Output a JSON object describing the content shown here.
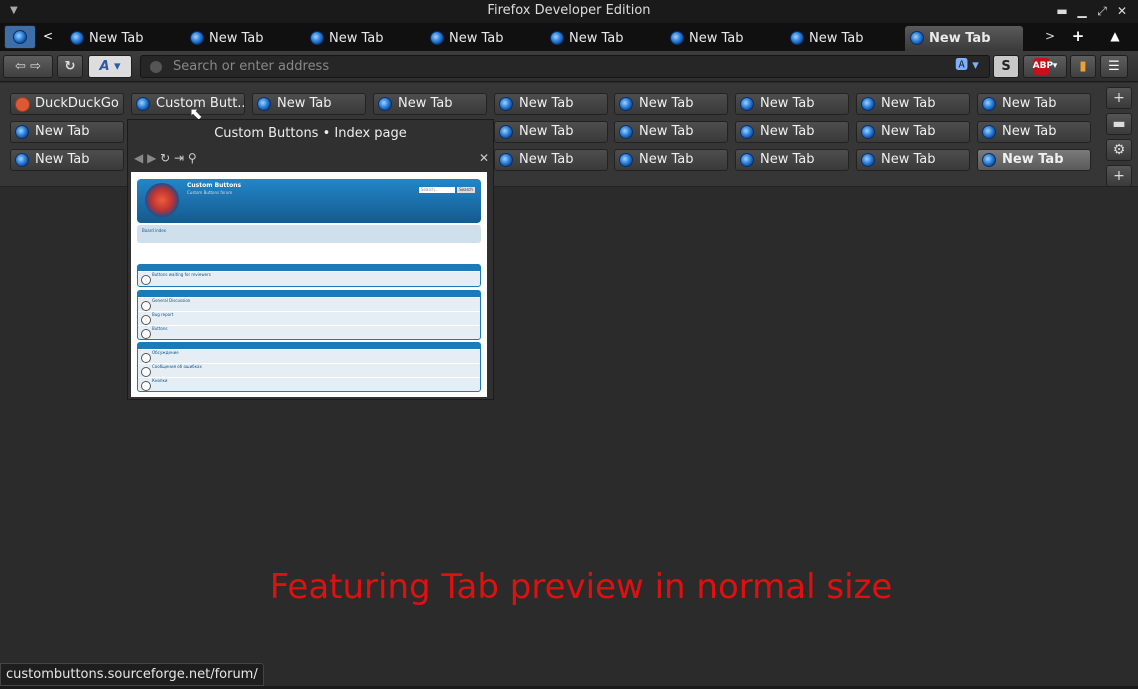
{
  "window": {
    "title": "Firefox Developer Edition"
  },
  "tabs": [
    {
      "label": "New Tab"
    },
    {
      "label": "New Tab"
    },
    {
      "label": "New Tab"
    },
    {
      "label": "New Tab"
    },
    {
      "label": "New Tab"
    },
    {
      "label": "New Tab"
    },
    {
      "label": "New Tab"
    },
    {
      "label": "New Tab",
      "active": true
    }
  ],
  "navbar": {
    "url_placeholder": "Search or enter address"
  },
  "tiles": {
    "row1": [
      "DuckDuckGo",
      "Custom Butt...",
      "New Tab",
      "New Tab",
      "New Tab",
      "New Tab",
      "New Tab",
      "New Tab",
      "New Tab"
    ],
    "row2": [
      "New Tab",
      "New Tab",
      "New Tab",
      "New Tab",
      "New Tab",
      "New Tab"
    ],
    "row3": [
      "New Tab",
      "New Tab",
      "New Tab",
      "New Tab",
      "New Tab",
      "New Tab"
    ]
  },
  "preview": {
    "title": "Custom Buttons • Index page",
    "site": {
      "title": "Custom Buttons",
      "subtitle": "Custom Buttons forum",
      "search_placeholder": "Search...",
      "search_button": "Search",
      "board_index": "Board index",
      "sections": [
        {
          "rows": [
            "Buttons waiting for reviewers"
          ]
        },
        {
          "rows": [
            "General Discussion",
            "Bug report",
            "Buttons"
          ]
        },
        {
          "rows": [
            "Обсуждение",
            "Сообщения об ошибках",
            "Кнопки"
          ]
        }
      ]
    }
  },
  "statusbar": {
    "url": "custombuttons.sourceforge.net/forum/"
  },
  "caption": "Featuring Tab preview in normal size"
}
